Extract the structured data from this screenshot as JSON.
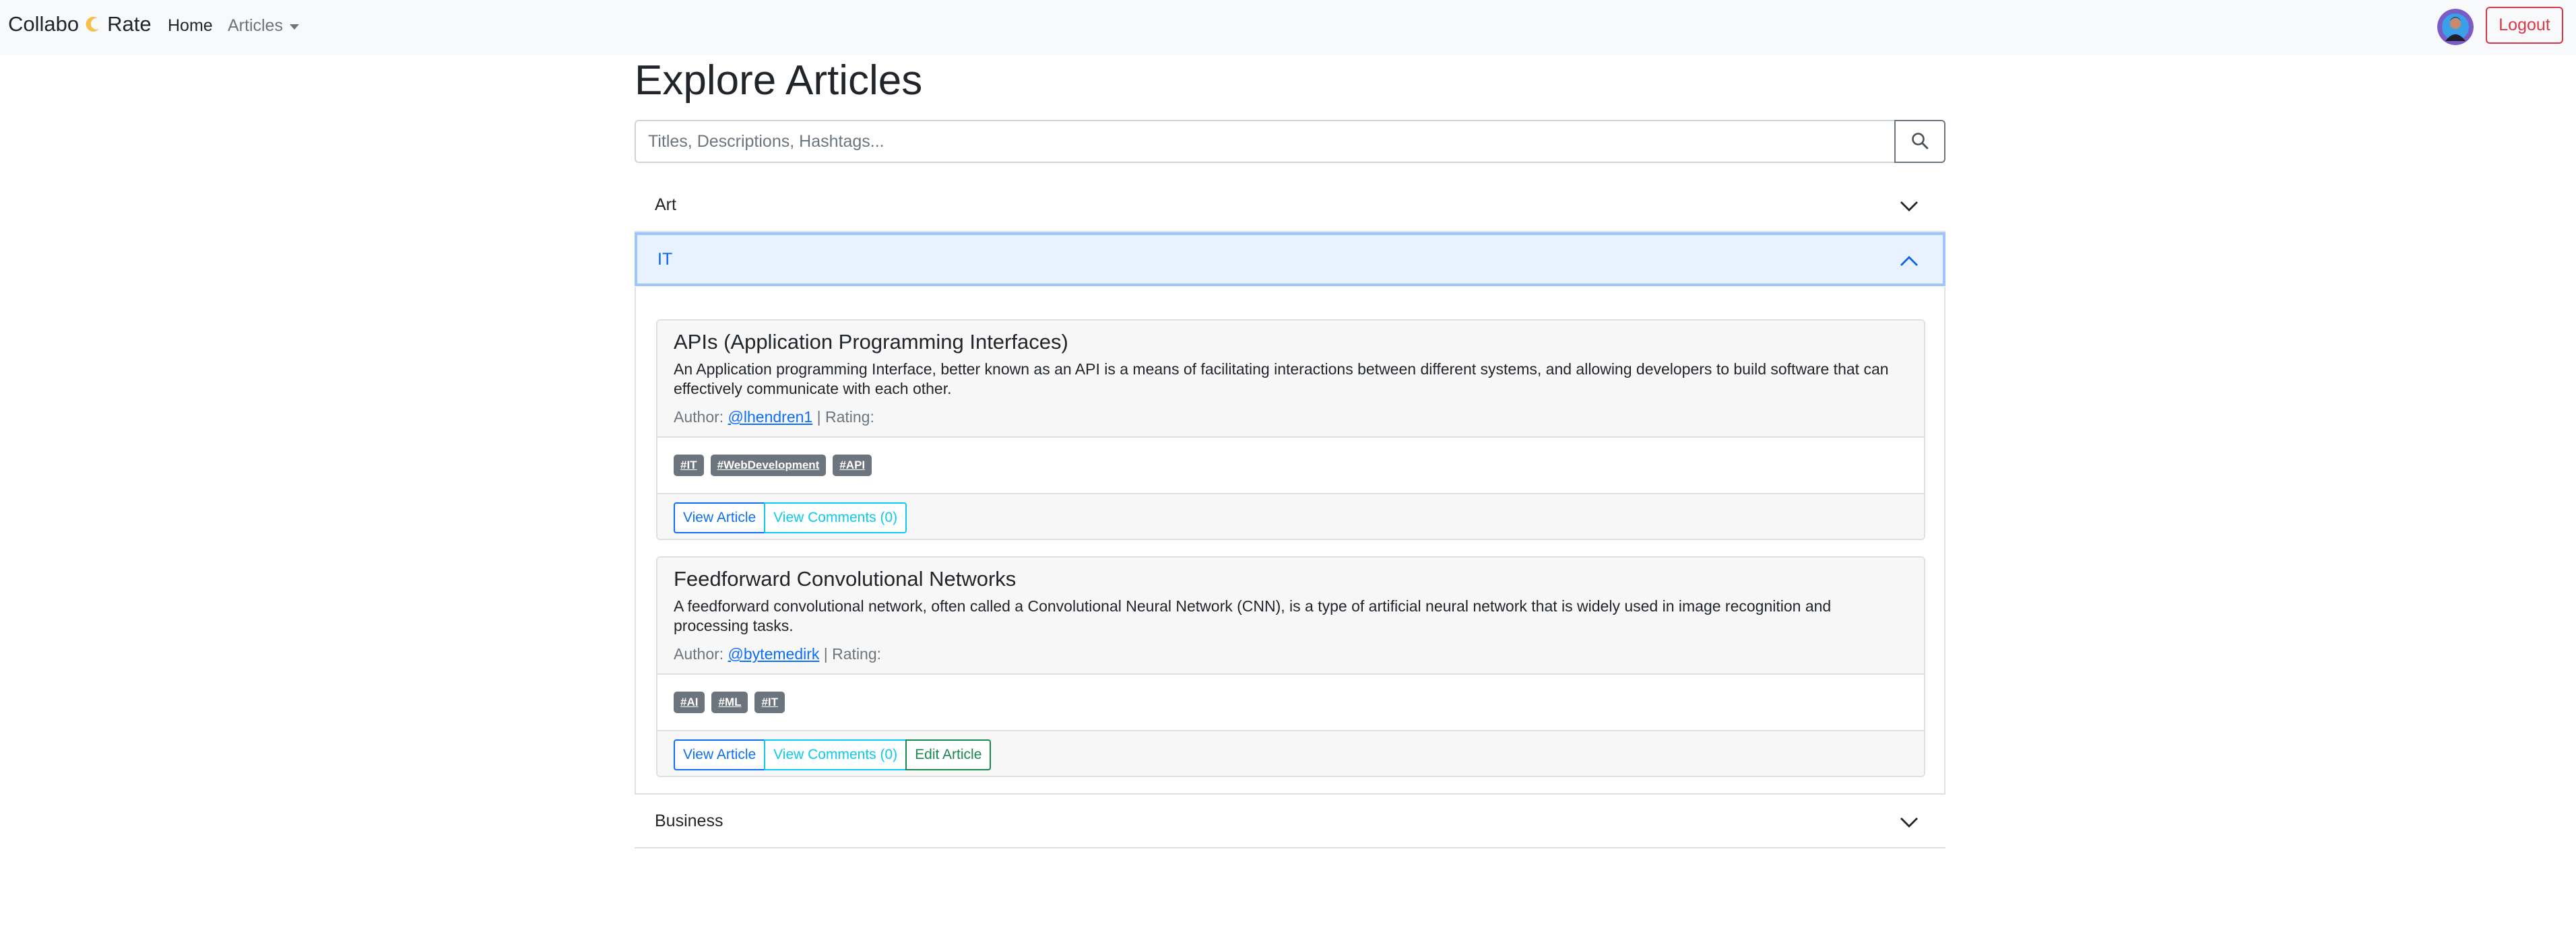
{
  "navbar": {
    "brand_left": "Collabo",
    "brand_right": "Rate",
    "home_label": "Home",
    "articles_label": "Articles",
    "logout_label": "Logout",
    "logo_icon": "crescent-logo-icon",
    "avatar_icon": "user-avatar"
  },
  "page": {
    "title": "Explore Articles",
    "search_placeholder": "Titles, Descriptions, Hashtags...",
    "search_icon": "search-icon"
  },
  "accordion": [
    {
      "label": "Art",
      "expanded": false,
      "icon": "chevron-down-icon"
    },
    {
      "label": "IT",
      "expanded": true,
      "icon": "chevron-up-icon"
    },
    {
      "label": "Business",
      "expanded": false,
      "icon": "chevron-down-icon"
    }
  ],
  "articles": [
    {
      "title": "APIs (Application Programming Interfaces)",
      "description": "An Application programming Interface, better known as an API is a means of facilitating interactions between different systems, and allowing developers to build software that can effectively communicate with each other.",
      "author_prefix": "Author:",
      "author": "@lhendren1",
      "rating_text": "| Rating:",
      "tags": [
        "#IT",
        "#WebDevelopment",
        "#API"
      ],
      "view_label": "View Article",
      "comments_label": "View Comments (0)"
    },
    {
      "title": "Feedforward Convolutional Networks",
      "description": "A feedforward convolutional network, often called a Convolutional Neural Network (CNN), is a type of artificial neural network that is widely used in image recognition and processing tasks.",
      "author_prefix": "Author:",
      "author": "@bytemedirk",
      "rating_text": "| Rating:",
      "tags": [
        "#AI",
        "#ML",
        "#IT"
      ],
      "view_label": "View Article",
      "comments_label": "View Comments (0)",
      "edit_label": "Edit Article"
    }
  ],
  "colors": {
    "primary": "#0d6efd",
    "info": "#0dcaf0",
    "success": "#198754",
    "danger": "#dc3545",
    "secondary": "#6c757d"
  }
}
